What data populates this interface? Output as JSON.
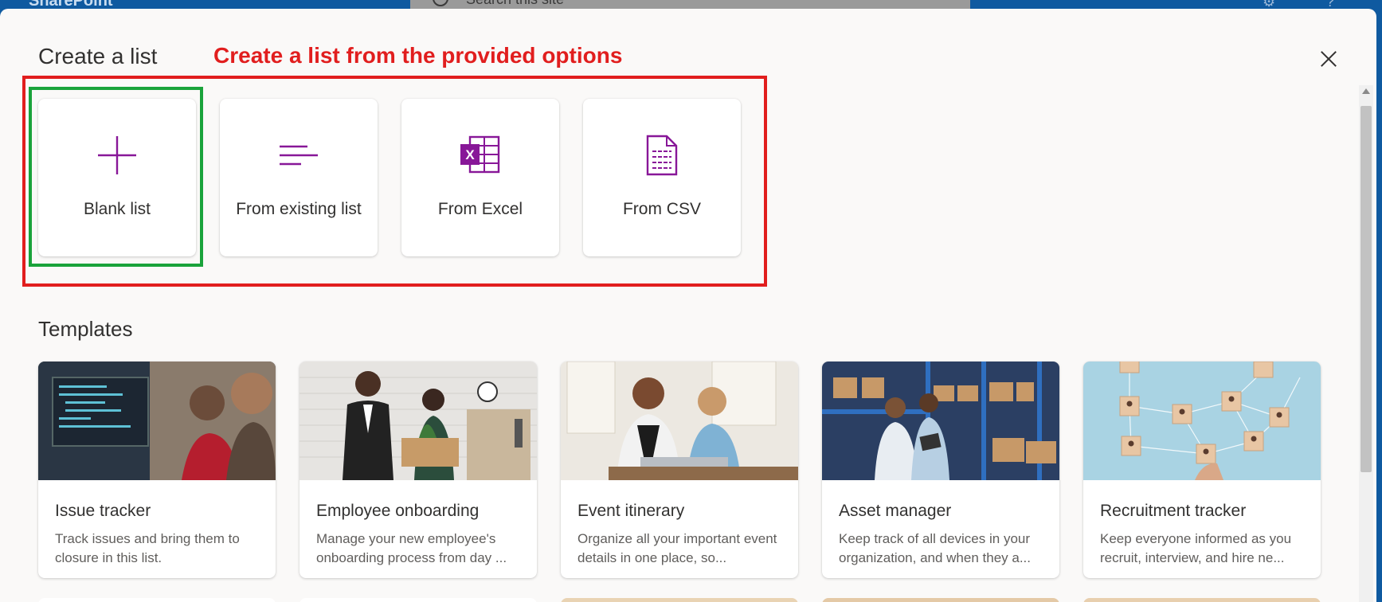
{
  "topbar": {
    "brand": "SharePoint",
    "search_placeholder": "Search this site"
  },
  "panel": {
    "title": "Create a list",
    "annotation": "Create a list from the provided options",
    "close_icon": "close-icon"
  },
  "options": [
    {
      "label": "Blank list",
      "icon": "plus-icon"
    },
    {
      "label": "From existing list",
      "icon": "list-lines-icon"
    },
    {
      "label": "From Excel",
      "icon": "excel-icon"
    },
    {
      "label": "From CSV",
      "icon": "csv-file-icon"
    }
  ],
  "templates_section": {
    "title": "Templates",
    "items": [
      {
        "title": "Issue tracker",
        "description": "Track issues and bring them to closure in this list."
      },
      {
        "title": "Employee onboarding",
        "description": "Manage your new employee's onboarding process from day ..."
      },
      {
        "title": "Event itinerary",
        "description": "Organize all your important event details in one place, so..."
      },
      {
        "title": "Asset manager",
        "description": "Keep track of all devices in your organization, and when they a..."
      },
      {
        "title": "Recruitment tracker",
        "description": "Keep everyone informed as you recruit, interview, and hire ne..."
      }
    ]
  },
  "colors": {
    "accent": "#881798",
    "annotation_red": "#e11e1e",
    "annotation_green": "#1aa33b",
    "brand_blue": "#0f5aa0"
  }
}
